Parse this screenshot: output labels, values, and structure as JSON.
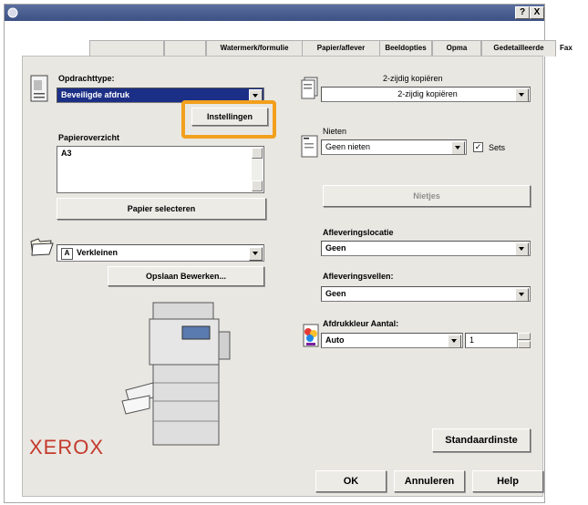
{
  "window": {
    "help_btn": "?",
    "close_btn": "X"
  },
  "tabs": [
    {
      "label": ""
    },
    {
      "label": ""
    },
    {
      "label": "Watermerk/formulie"
    },
    {
      "label": "Papier/aflever"
    },
    {
      "label": "Beeldopties"
    },
    {
      "label": "Opma"
    },
    {
      "label": "Gedetailleerde"
    },
    {
      "label": "Fax"
    }
  ],
  "left": {
    "job_type_label": "Opdrachttype:",
    "job_type_value": "Beveiligde afdruk",
    "settings_button": "Instellingen",
    "paper_overview_label": "Papieroverzicht",
    "paper_overview_value": "A3",
    "select_paper_button": "Papier selecteren",
    "reduce_value": "Verkleinen",
    "reduce_prefix_glyph": "A",
    "save_edit_button": "Opslaan Bewerken..."
  },
  "right": {
    "duplex_label": "2-zijdig kopiëren",
    "duplex_value": "2-zijdig kopiëren",
    "staple_label": "Nieten",
    "staple_value": "Geen nieten",
    "sets_checkbox_label": "Sets",
    "sets_checkmark": "✓",
    "staple_button": "Nietjes",
    "delivery_location_label": "Afleveringslocatie",
    "delivery_location_value": "Geen",
    "delivery_sheets_label": "Afleveringsvellen:",
    "delivery_sheets_value": "Geen",
    "print_color_label": "Afdrukkleur Aantal:",
    "print_color_value": "Auto",
    "copies_value": "1"
  },
  "footer": {
    "brand": "XEROX",
    "defaults_button": "Standaardinste",
    "ok_button": "OK",
    "cancel_button": "Annuleren",
    "help_button": "Help"
  },
  "colors": {
    "highlight": "#f2a01d",
    "selection": "#1c2f86",
    "brand": "#c43a2c"
  }
}
